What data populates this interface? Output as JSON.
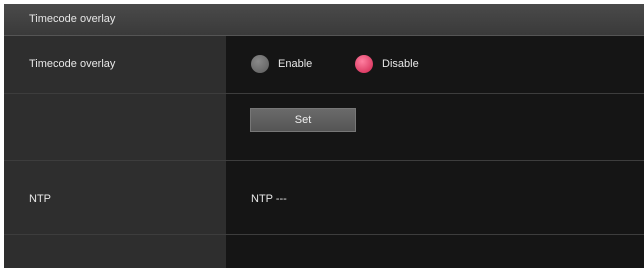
{
  "section": {
    "title": "Timecode overlay"
  },
  "timecode_overlay": {
    "label": "Timecode overlay",
    "options": [
      "Enable",
      "Disable"
    ],
    "selected": "Disable",
    "set_label": "Set"
  },
  "ntp": {
    "label": "NTP",
    "value": "NTP ---"
  },
  "colors": {
    "selected_radio": "#d0244f",
    "unselected_radio": "#6e6e6e",
    "label_column": "#2e2e2e",
    "value_column": "#151515"
  }
}
